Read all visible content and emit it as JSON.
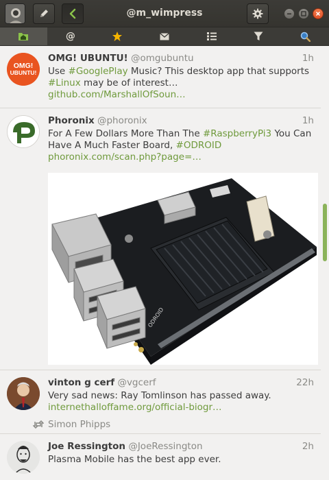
{
  "window": {
    "title": "@m_wimpress"
  },
  "tabs": [
    {
      "icon": "home-icon",
      "active": true
    },
    {
      "icon": "mentions-icon",
      "label": "@"
    },
    {
      "icon": "favorites-icon"
    },
    {
      "icon": "messages-icon"
    },
    {
      "icon": "lists-icon"
    },
    {
      "icon": "filters-icon"
    },
    {
      "icon": "search-icon"
    }
  ],
  "tweets": [
    {
      "name": "OMG! UBUNTU!",
      "handle": "@omgubuntu",
      "time": "1h",
      "text_pre": "Use ",
      "hashtag1": "#GooglePlay",
      "text_mid": " Music? This desktop app that supports ",
      "hashtag2": "#Linux",
      "text_post": " may be of interest… ",
      "link": "github.com/MarshallOfSoun…",
      "avatar_text": "OMG!\nUBUNTU!",
      "avatar_color": "#e95420"
    },
    {
      "name": "Phoronix",
      "handle": "@phoronix",
      "time": "1h",
      "text_pre": "For A Few Dollars More Than The ",
      "hashtag1": "#RaspberryPi3",
      "text_mid": " You Can Have A Much Faster Board, ",
      "hashtag2": "#ODROID",
      "link": "phoronix.com/scan.php?page=…",
      "board_label": "ODROID",
      "avatar_color": "#3a6b2a"
    },
    {
      "name": "vinton g cerf",
      "handle": "@vgcerf",
      "time": "22h",
      "text": "Very sad news: Ray Tomlinson has passed away.",
      "link": "internethalloffame.org/official-biogr…",
      "retweeted_by": "Simon Phipps"
    },
    {
      "name": "Joe Ressington",
      "handle": "@JoeRessington",
      "time": "2h",
      "text": "Plasma Mobile has the best app ever."
    }
  ],
  "colors": {
    "accent": "#6f9a3c",
    "titlebar": "#3c3b37",
    "close": "#e0522a"
  }
}
